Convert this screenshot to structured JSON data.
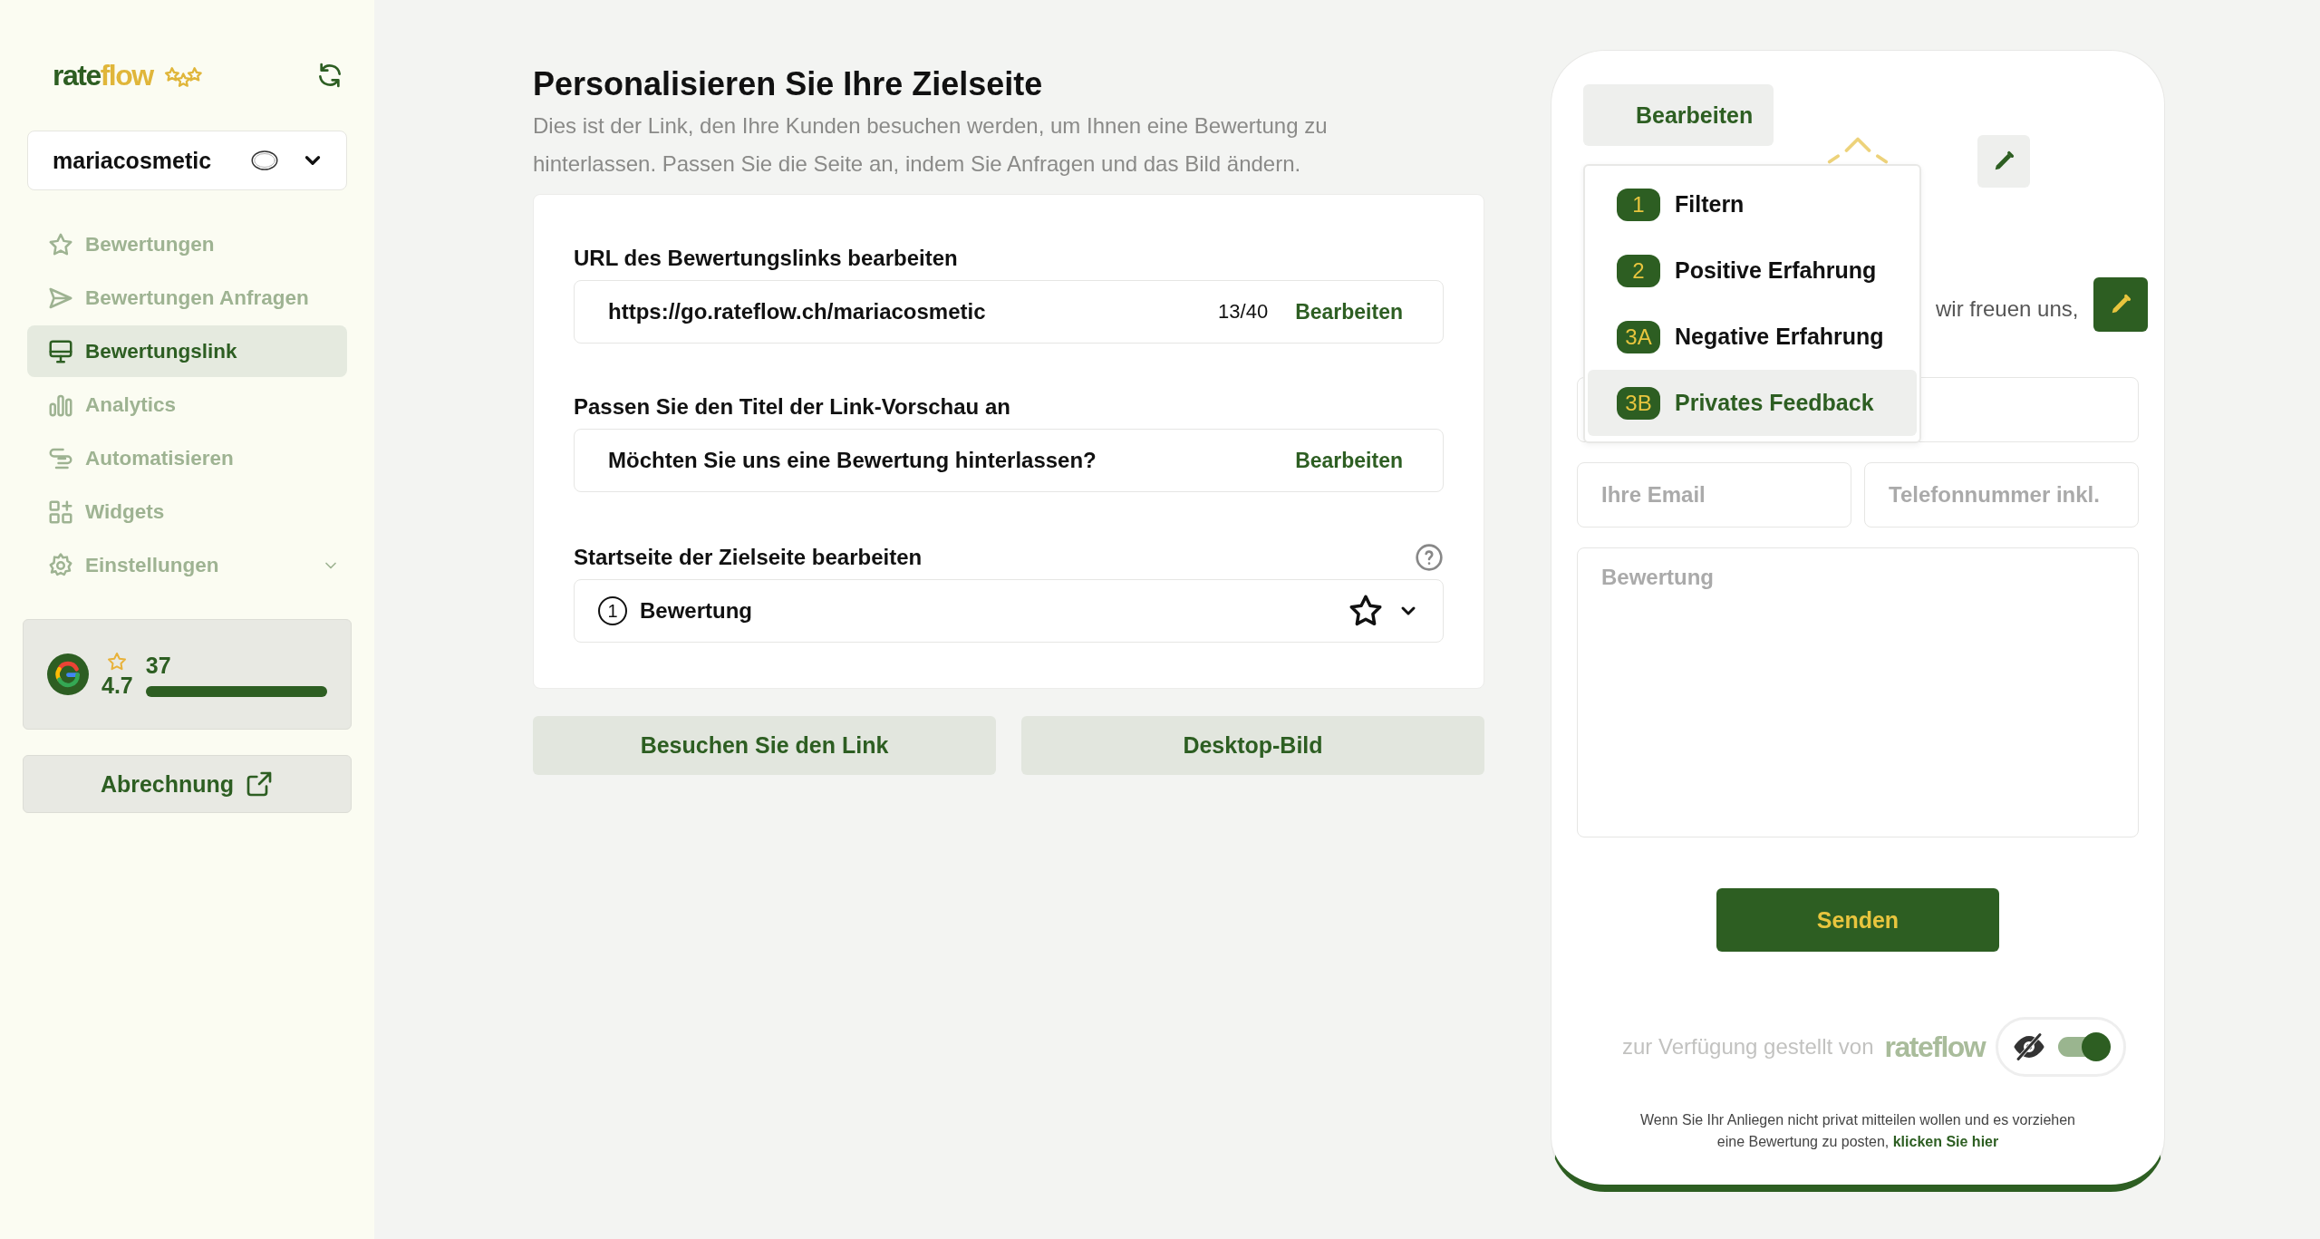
{
  "sidebar": {
    "logo": {
      "part_1": "rate",
      "part_2": "flow"
    },
    "account": {
      "name": "mariacosmetic"
    },
    "nav": [
      {
        "label": "Bewertungen",
        "kind": "link",
        "selected": false
      },
      {
        "label": "Bewertungen Anfragen",
        "kind": "link",
        "selected": false
      },
      {
        "label": "Bewertungslink",
        "kind": "link",
        "selected": true
      },
      {
        "label": "Analytics",
        "kind": "link",
        "selected": false
      },
      {
        "label": "Automatisieren",
        "kind": "link",
        "selected": false
      },
      {
        "label": "Widgets",
        "kind": "link",
        "selected": false
      },
      {
        "label": "Einstellungen",
        "kind": "group",
        "selected": false
      }
    ],
    "rating_card": {
      "rating": "4.7",
      "count": "37",
      "level": 1.0
    },
    "billing_button": "Abrechnung"
  },
  "main": {
    "title": "Personalisieren Sie Ihre Zielseite",
    "subtitle": "Dies ist der Link, den Ihre Kunden besuchen werden, um Ihnen eine Bewertung zu hinterlassen. Passen Sie die Seite an, indem Sie Anfragen und das Bild ändern.",
    "url_section": {
      "label": "URL des Bewertungslinks bearbeiten",
      "value": "https://go.rateflow.ch/mariacosmetic",
      "counter": "13/40",
      "action": "Bearbeiten"
    },
    "title_section": {
      "label": "Passen Sie den Titel der Link-Vorschau an",
      "value": "Möchten Sie uns eine Bewertung hinterlassen?",
      "action": "Bearbeiten"
    },
    "start_section": {
      "label": "Startseite der Zielseite bearbeiten",
      "step": "1",
      "value": "Bewertung"
    },
    "buttons": [
      "Besuchen Sie den Link",
      "Desktop-Bild"
    ]
  },
  "preview": {
    "edit_button": "Bearbeiten",
    "menu": [
      {
        "number": "1",
        "label": "Filtern",
        "selected": false
      },
      {
        "number": "2",
        "label": "Positive Erfahrung",
        "selected": false
      },
      {
        "number": "3A",
        "label": "Negative Erfahrung",
        "selected": false
      },
      {
        "number": "3B",
        "label": "Privates Feedback",
        "selected": true
      }
    ],
    "intro_visible": "wir freuen uns,",
    "email_placeholder": "Ihre Email",
    "phone_placeholder": "Telefonnummer inkl.",
    "review_placeholder": "Bewertung",
    "submit": "Senden",
    "powered_by": "zur Verfügung gestellt von",
    "powered_logo": "rateflow",
    "branding_toggle": {
      "on": true
    },
    "note": "Wenn Sie Ihr Anliegen nicht privat mitteilen wollen und es vorziehen eine Bewertung zu posten,",
    "note_link": "klicken Sie hier"
  }
}
